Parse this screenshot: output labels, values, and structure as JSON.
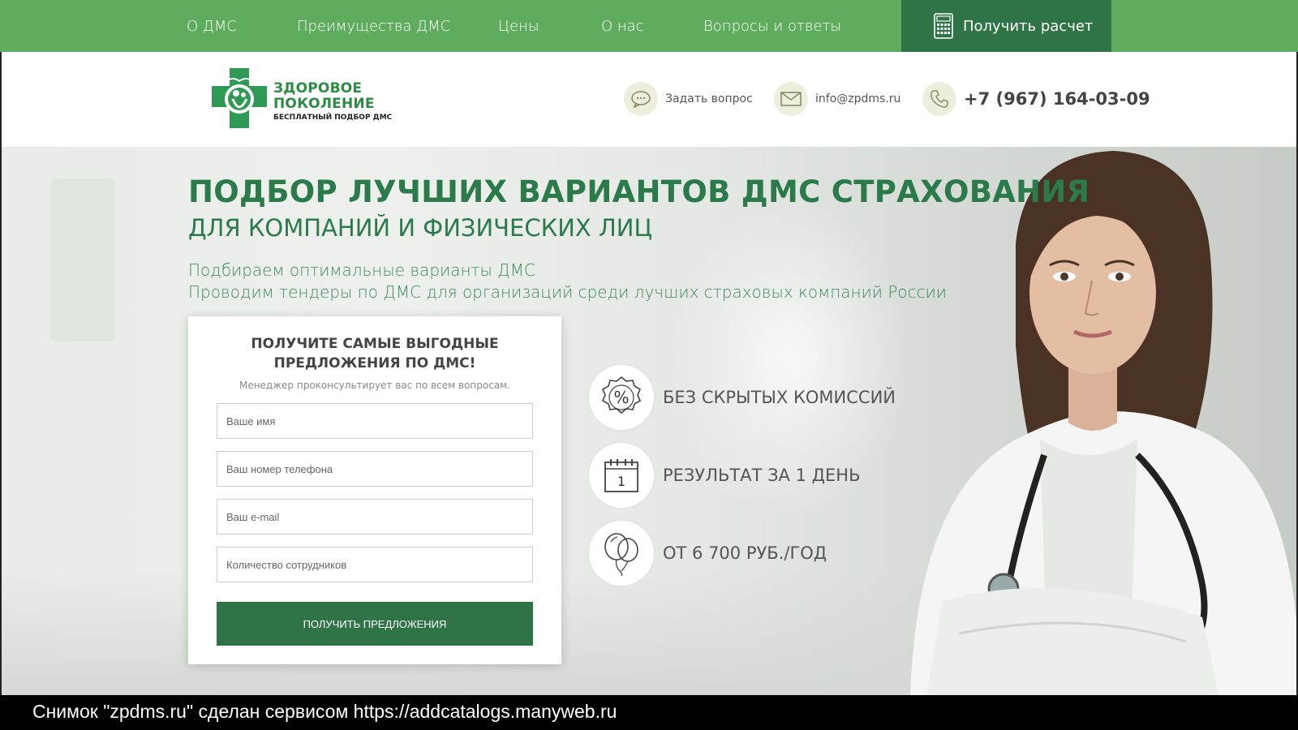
{
  "nav": {
    "items": [
      "О ДМС",
      "Преимущества ДМС",
      "Цены",
      "О нас",
      "Вопросы и ответы"
    ],
    "cta_label": "Получить расчет"
  },
  "header": {
    "logo_line1": "ЗДОРОВОЕ",
    "logo_line2": "ПОКОЛЕНИЕ",
    "logo_tagline": "БЕСПЛАТНЫЙ ПОДБОР ДМС",
    "ask_label": "Задать вопрос",
    "email": "info@zpdms.ru",
    "phone": "+7 (967) 164-03-09"
  },
  "hero": {
    "title": "ПОДБОР ЛУЧШИХ ВАРИАНТОВ ДМС СТРАХОВАНИЯ",
    "subtitle": "ДЛЯ КОМПАНИЙ И ФИЗИЧЕСКИХ ЛИЦ",
    "line1": "Подбираем оптимальные варианты ДМС",
    "line2": "Проводим тендеры по ДМС для организаций среди лучших страховых компаний России"
  },
  "form": {
    "title_line1": "ПОЛУЧИТЕ САМЫЕ ВЫГОДНЫЕ",
    "title_line2": "ПРЕДЛОЖЕНИЯ ПО ДМС!",
    "subtitle": "Менеджер проконсультирует вас по всем вопросам.",
    "name_placeholder": "Ваше имя",
    "phone_placeholder": "Ваш номер телефона",
    "email_placeholder": "Ваш e-mail",
    "employees_placeholder": "Количество сотрудников",
    "submit_label": "ПОЛУЧИТЬ ПРЕДЛОЖЕНИЯ"
  },
  "features": [
    {
      "label": "БЕЗ СКРЫТЫХ КОМИССИЙ",
      "icon": "percent-badge-icon"
    },
    {
      "label": "РЕЗУЛЬТАТ ЗА 1 ДЕНЬ",
      "icon": "calendar-icon",
      "icon_text": "1"
    },
    {
      "label": "ОТ 6 700 РУБ./ГОД",
      "icon": "balloons-icon"
    }
  ],
  "caption": "Снимок \"zpdms.ru\" сделан сервисом https://addcatalogs.manyweb.ru",
  "colors": {
    "nav_green": "#5fac5f",
    "dark_green": "#2e7446",
    "title_green": "#2a7a4a"
  }
}
